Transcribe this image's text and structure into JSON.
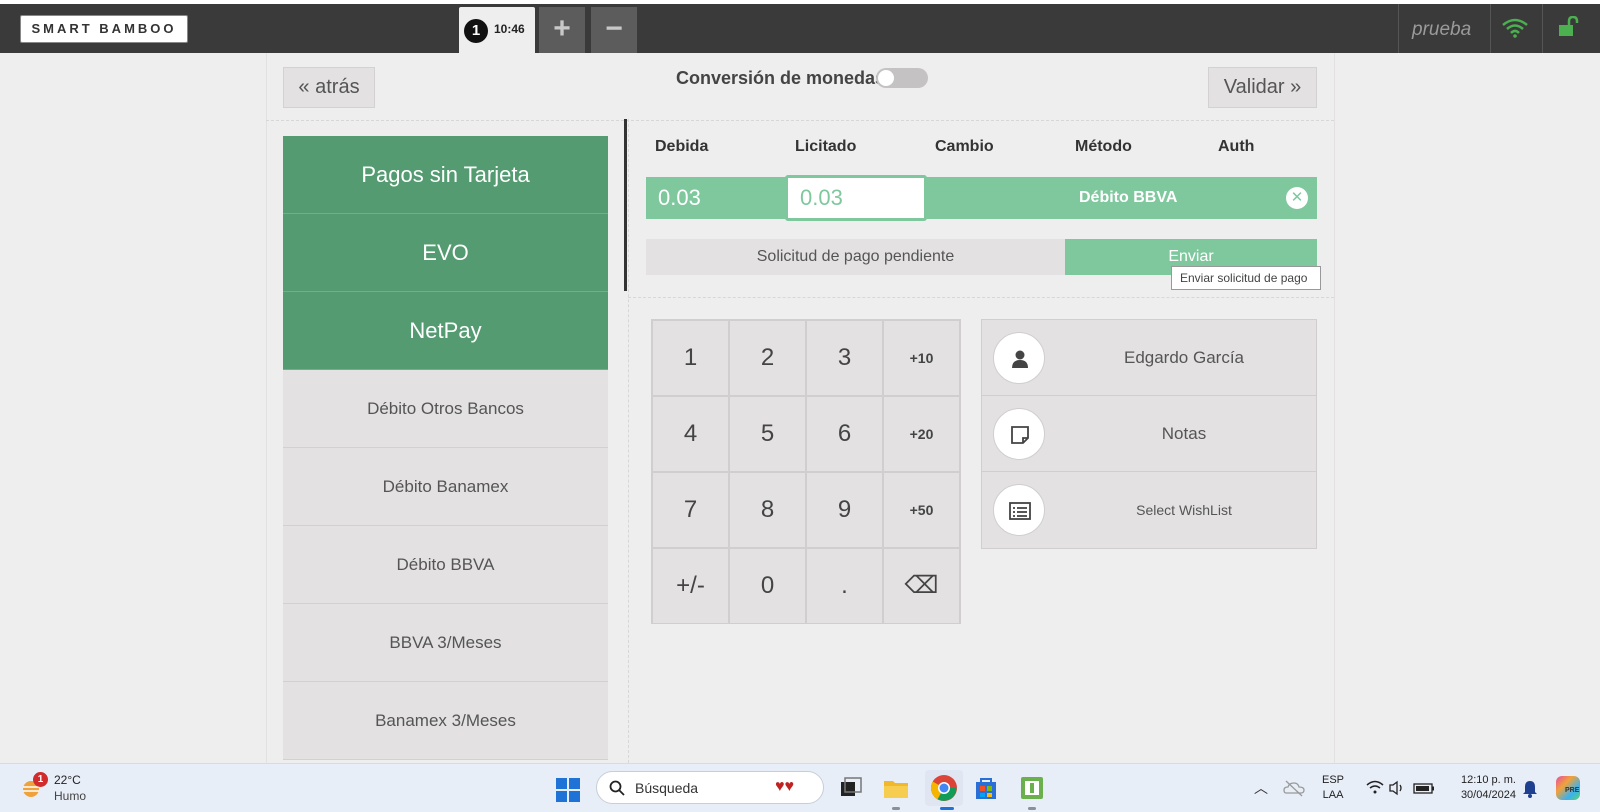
{
  "app": {
    "logo_text": "SMART BAMBOO",
    "order_number": "1",
    "order_time": "10:46",
    "add_order_label": "+",
    "remove_order_label": "−",
    "user_label": "prueba",
    "wifi_icon": "wifi-icon",
    "lock_icon": "unlock-icon"
  },
  "header": {
    "back_label": "« atrás",
    "currency_conversion_label": "Conversión de monedas",
    "currency_conversion_on": false,
    "validate_label": "Validar »"
  },
  "payment_methods": [
    {
      "label": "Pagos sin Tarjeta",
      "highlight": true
    },
    {
      "label": "EVO",
      "highlight": true
    },
    {
      "label": "NetPay",
      "highlight": true
    },
    {
      "label": "Débito Otros Bancos",
      "highlight": false
    },
    {
      "label": "Débito Banamex",
      "highlight": false
    },
    {
      "label": "Débito BBVA",
      "highlight": false
    },
    {
      "label": "BBVA 3/Meses",
      "highlight": false
    },
    {
      "label": "Banamex 3/Meses",
      "highlight": false
    }
  ],
  "payment_table": {
    "headers": [
      "Debida",
      "Licitado",
      "Cambio",
      "Método",
      "Auth"
    ],
    "row": {
      "due": "0.03",
      "tendered": "0.03",
      "change": "",
      "method": "Débito BBVA",
      "auth": ""
    },
    "pending_label": "Solicitud de pago pendiente",
    "send_label": "Enviar",
    "send_tooltip": "Enviar solicitud de pago"
  },
  "keypad": {
    "keys": [
      "1",
      "2",
      "3",
      "+10",
      "4",
      "5",
      "6",
      "+20",
      "7",
      "8",
      "9",
      "+50",
      "+/-",
      "0",
      ".",
      "⌫"
    ]
  },
  "actions": [
    {
      "label": "Edgardo García",
      "icon": "user-icon"
    },
    {
      "label": "Notas",
      "icon": "note-icon"
    },
    {
      "label": "Select WishList",
      "icon": "list-icon"
    }
  ],
  "taskbar": {
    "weather_temp": "22°C",
    "weather_desc": "Humo",
    "weather_badge": "1",
    "search_placeholder": "Búsqueda",
    "lang_1": "ESP",
    "lang_2": "LAA",
    "time": "12:10 p. m.",
    "date": "30/04/2024",
    "copilot_badge": "PRE"
  },
  "colors": {
    "green_dark": "#559b72",
    "green_light": "#7fc89e",
    "topbar": "#3a3a3a",
    "wifi_green": "#4caf50"
  }
}
